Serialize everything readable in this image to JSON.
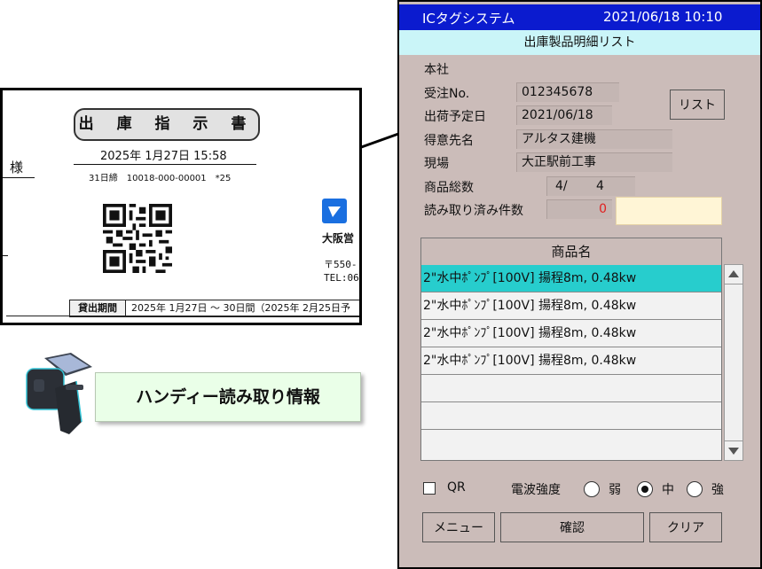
{
  "document": {
    "title": "出 庫 指 示 書",
    "datetime": "2025年 1月27日 15:58",
    "code_line": "31日締　10018-000-00001　*25",
    "honorific": "様",
    "company_name": "大阪営",
    "postal": "〒550-",
    "tel": "TEL:06",
    "period_label": "貸出期間",
    "period_value": "2025年 1月27日 〜 30日間（2025年 2月25日予"
  },
  "handy_label": "ハンディー読み取り情報",
  "device": {
    "app_title": "ICタグシステム",
    "datetime": "2021/06/18 10:10",
    "screen_title": "出庫製品明細リスト",
    "company": "本社",
    "fields": {
      "order_no": {
        "label": "受注No.",
        "value": "012345678"
      },
      "ship_date": {
        "label": "出荷予定日",
        "value": "2021/06/18"
      },
      "customer": {
        "label": "得意先名",
        "value": "アルタス建機"
      },
      "site": {
        "label": "現場",
        "value": "大正駅前工事"
      },
      "total": {
        "label": "商品総数",
        "value_left": "4/",
        "value_right": "4"
      },
      "read_count": {
        "label": "読み取り済み件数",
        "value": "0"
      }
    },
    "list_button": "リスト",
    "list": {
      "header": "商品名",
      "rows": [
        "2\"水中ﾎﾟﾝﾌﾟ[100V]  揚程8m, 0.48kw",
        "2\"水中ﾎﾟﾝﾌﾟ[100V]  揚程8m, 0.48kw",
        "2\"水中ﾎﾟﾝﾌﾟ[100V]  揚程8m, 0.48kw",
        "2\"水中ﾎﾟﾝﾌﾟ[100V]  揚程8m, 0.48kw",
        "",
        "",
        ""
      ],
      "selected_index": 0
    },
    "options": {
      "qr_label": "QR",
      "qr_checked": false,
      "signal_label": "電波強度",
      "signal_levels": [
        "弱",
        "中",
        "強"
      ],
      "signal_selected": "中"
    },
    "buttons": {
      "menu": "メニュー",
      "confirm": "確認",
      "clear": "クリア"
    }
  },
  "colors": {
    "header_bg": "#0b1bcf",
    "subheader_bg": "#caf5f8",
    "panel_bg": "#cbbcb9",
    "selected_row": "#27cdcd",
    "read_count_text": "#e02020",
    "read_input_bg": "#fff5d6",
    "label_bg": "#eaffe8"
  }
}
